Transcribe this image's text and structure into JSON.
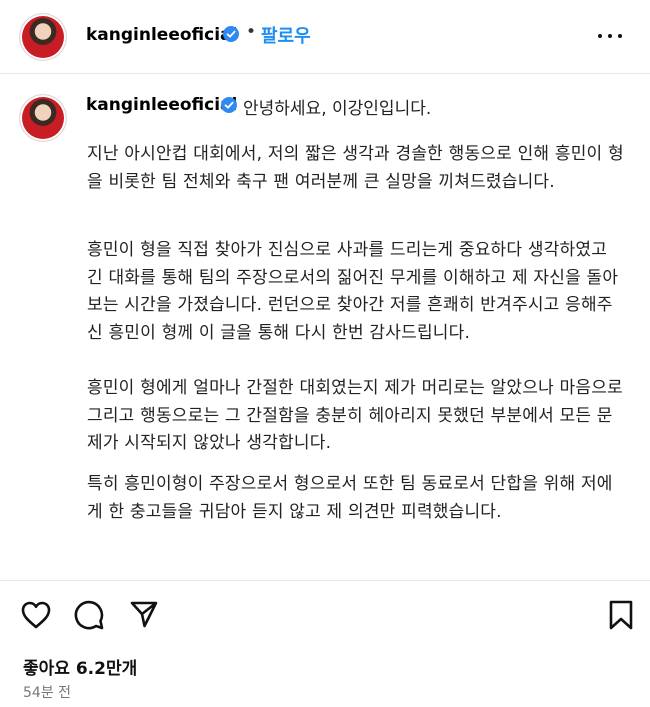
{
  "post": {
    "username": "kanginleeoficial",
    "follow_label": "팔로우",
    "separator": "•"
  },
  "caption": {
    "username": "kanginleeoficial",
    "first_line": "안녕하세요, 이강인입니다.",
    "paragraphs": [
      "지난 아시안컵 대회에서, 저의 짧은 생각과 경솔한 행동으로 인해 흥민이 형을 비롯한 팀 전체와 축구 팬 여러분께 큰 실망을 끼쳐드렸습니다.",
      "흥민이 형을 직접 찾아가 진심으로 사과를 드리는게 중요하다 생각하였고 긴 대화를 통해 팀의 주장으로서의 짊어진 무게를 이해하고 제 자신을 돌아보는 시간을 가졌습니다. 런던으로 찾아간 저를 흔쾌히 반겨주시고 응해주신 흥민이 형께 이 글을 통해 다시 한번 감사드립니다.",
      "흥민이 형에게 얼마나 간절한 대회였는지 제가 머리로는 알았으나 마음으로 그리고 행동으로는 그 간절함을 충분히 헤아리지 못했던 부분에서 모든 문제가 시작되지 않았나 생각합니다.",
      "특히 흥민이형이 주장으로서 형으로서 또한 팀 동료로서 단합을 위해 저에게 한 충고들을 귀담아 듣지 않고 제 의견만 피력했습니다."
    ]
  },
  "engagement": {
    "likes_text": "좋아요 6.2만개",
    "time_text": "54분 전"
  },
  "icons": {
    "like": "heart-icon",
    "comment": "comment-icon",
    "share": "send-icon",
    "save": "bookmark-icon",
    "more": "more-options-icon",
    "verified": "verified-badge-icon"
  },
  "colors": {
    "follow": "#1f8ef1",
    "verified": "#2f89f0"
  }
}
